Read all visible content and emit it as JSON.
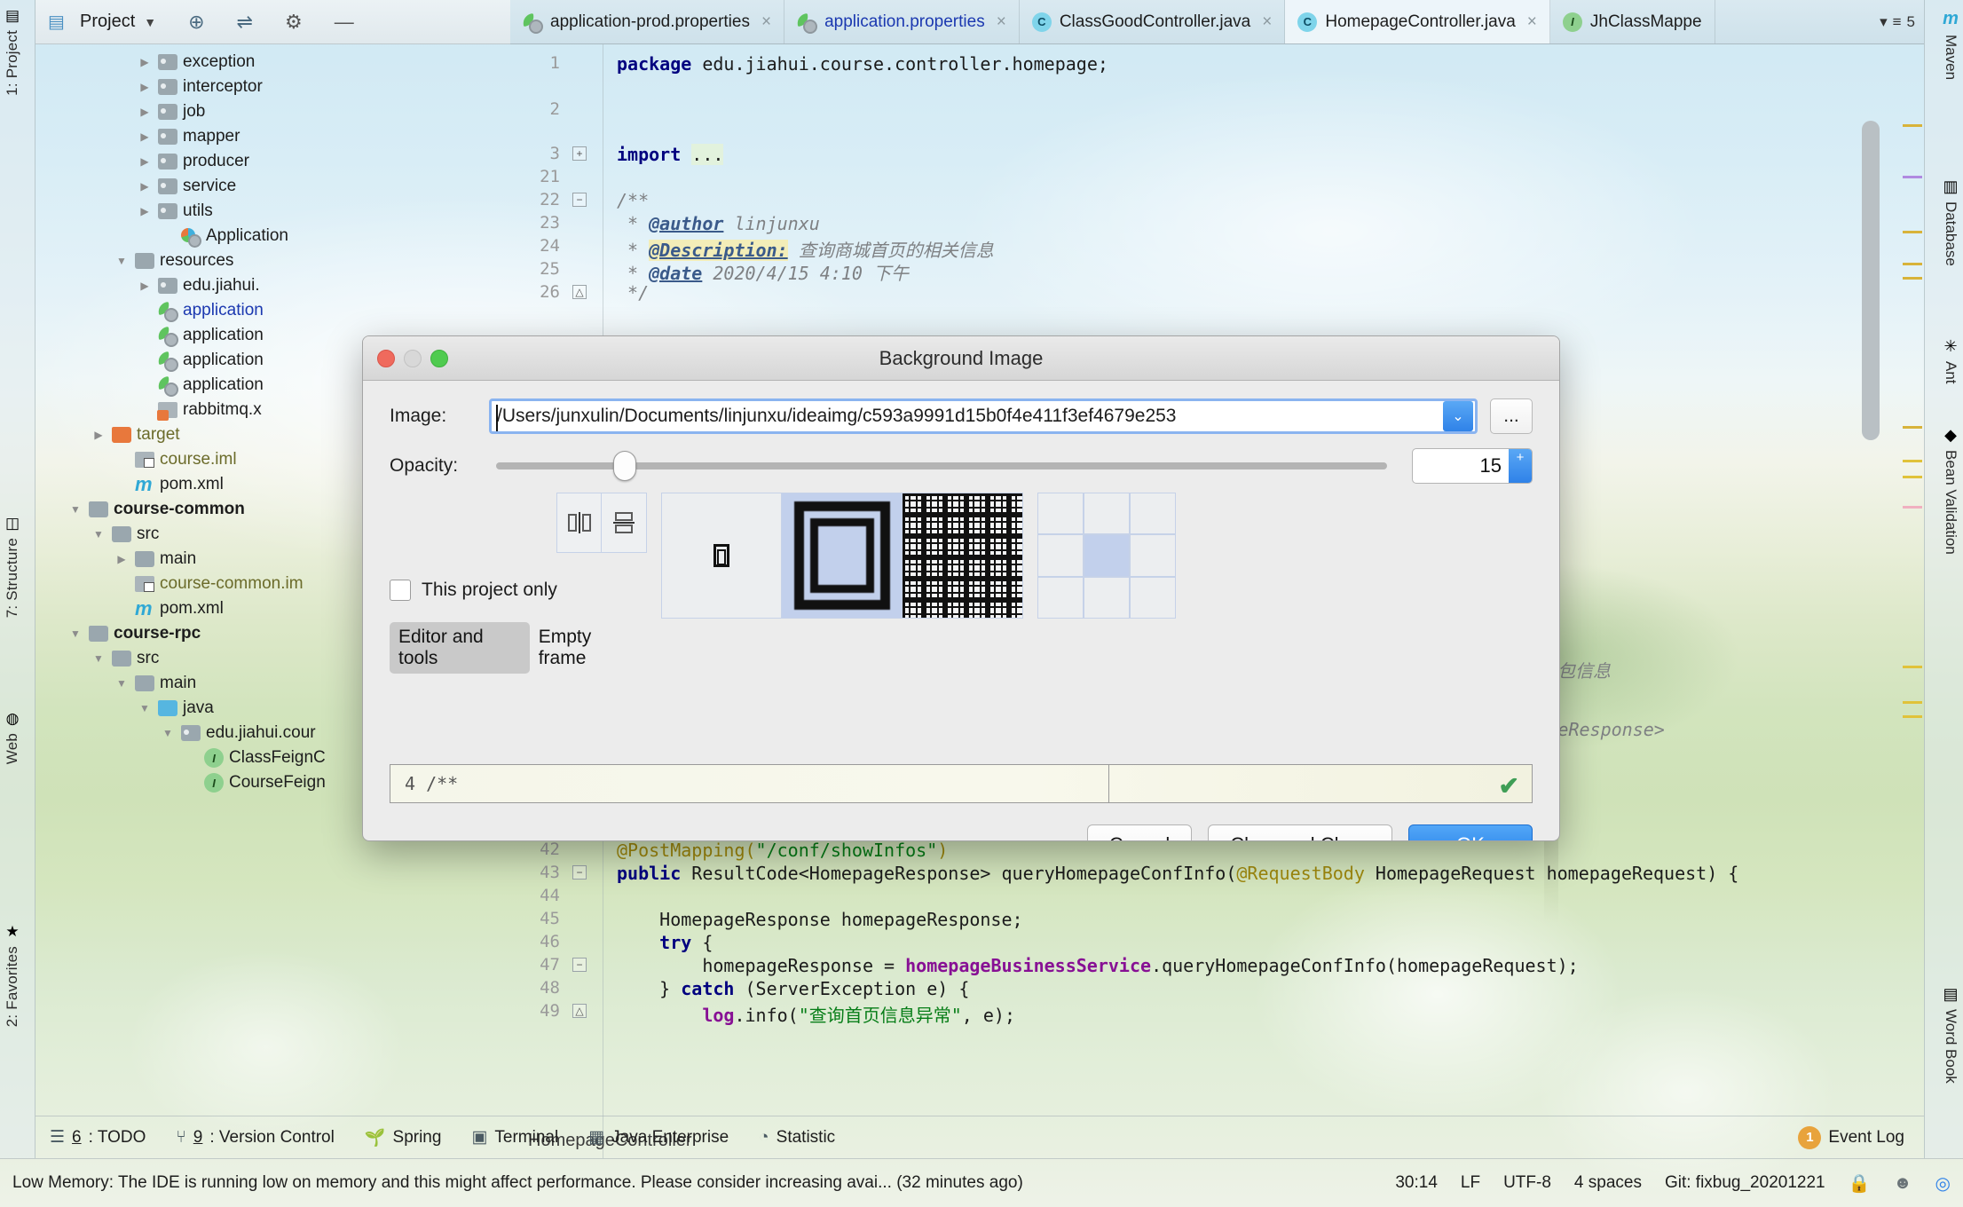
{
  "window": {
    "left_rail": [
      {
        "label": "1: Project",
        "icon": "project-icon"
      },
      {
        "label": "7: Structure",
        "icon": "structure-icon"
      },
      {
        "label": "Web",
        "icon": "web-icon"
      },
      {
        "label": "2: Favorites",
        "icon": "star-icon"
      }
    ],
    "right_rail": [
      {
        "label": "Maven",
        "icon": "maven-icon"
      },
      {
        "label": "Database",
        "icon": "database-icon"
      },
      {
        "label": "Ant",
        "icon": "ant-icon"
      },
      {
        "label": "Bean Validation",
        "icon": "bean-validation-icon"
      },
      {
        "label": "Word Book",
        "icon": "word-book-icon"
      }
    ]
  },
  "project_panel": {
    "title": "Project",
    "toolbar_icons": [
      "project-dropdown-icon",
      "locate-icon",
      "collapse-all-icon",
      "settings-gear-icon",
      "hide-icon"
    ],
    "tree": [
      {
        "label": "exception",
        "indent": 4,
        "arrow": "collapsed",
        "icon": "folder-package-icon",
        "style": ""
      },
      {
        "label": "interceptor",
        "indent": 4,
        "arrow": "collapsed",
        "icon": "folder-package-icon",
        "style": ""
      },
      {
        "label": "job",
        "indent": 4,
        "arrow": "collapsed",
        "icon": "folder-package-icon",
        "style": ""
      },
      {
        "label": "mapper",
        "indent": 4,
        "arrow": "collapsed",
        "icon": "folder-package-icon",
        "style": ""
      },
      {
        "label": "producer",
        "indent": 4,
        "arrow": "collapsed",
        "icon": "folder-package-icon",
        "style": ""
      },
      {
        "label": "service",
        "indent": 4,
        "arrow": "collapsed",
        "icon": "folder-package-icon",
        "style": ""
      },
      {
        "label": "utils",
        "indent": 4,
        "arrow": "collapsed",
        "icon": "folder-package-icon",
        "style": ""
      },
      {
        "label": "Application",
        "indent": 5,
        "arrow": "none",
        "icon": "spring-application-icon",
        "style": ""
      },
      {
        "label": "resources",
        "indent": 3,
        "arrow": "expanded",
        "icon": "folder-resources-icon",
        "style": ""
      },
      {
        "label": "edu.jiahui.",
        "indent": 4,
        "arrow": "collapsed",
        "icon": "folder-package-icon",
        "style": ""
      },
      {
        "label": "application",
        "indent": 4,
        "arrow": "none",
        "icon": "properties-icon",
        "style": "blue"
      },
      {
        "label": "application",
        "indent": 4,
        "arrow": "none",
        "icon": "properties-icon",
        "style": ""
      },
      {
        "label": "application",
        "indent": 4,
        "arrow": "none",
        "icon": "properties-icon",
        "style": ""
      },
      {
        "label": "application",
        "indent": 4,
        "arrow": "none",
        "icon": "properties-icon",
        "style": ""
      },
      {
        "label": "rabbitmq.x",
        "indent": 4,
        "arrow": "none",
        "icon": "xml-file-icon",
        "style": ""
      },
      {
        "label": "target",
        "indent": 2,
        "arrow": "collapsed",
        "icon": "folder-excluded-icon",
        "style": "olive"
      },
      {
        "label": "course.iml",
        "indent": 3,
        "arrow": "none",
        "icon": "iml-file-icon",
        "style": "olive"
      },
      {
        "label": "pom.xml",
        "indent": 3,
        "arrow": "none",
        "icon": "maven-pom-icon",
        "style": ""
      },
      {
        "label": "course-common",
        "indent": 1,
        "arrow": "expanded",
        "icon": "folder-module-icon",
        "style": "bold"
      },
      {
        "label": "src",
        "indent": 2,
        "arrow": "expanded",
        "icon": "folder-plain-icon",
        "style": ""
      },
      {
        "label": "main",
        "indent": 3,
        "arrow": "collapsed",
        "icon": "folder-plain-icon",
        "style": ""
      },
      {
        "label": "course-common.im",
        "indent": 3,
        "arrow": "none",
        "icon": "iml-file-icon",
        "style": "olive"
      },
      {
        "label": "pom.xml",
        "indent": 3,
        "arrow": "none",
        "icon": "maven-pom-icon",
        "style": ""
      },
      {
        "label": "course-rpc",
        "indent": 1,
        "arrow": "expanded",
        "icon": "folder-module-icon",
        "style": "bold"
      },
      {
        "label": "src",
        "indent": 2,
        "arrow": "expanded",
        "icon": "folder-plain-icon",
        "style": ""
      },
      {
        "label": "main",
        "indent": 3,
        "arrow": "expanded",
        "icon": "folder-plain-icon",
        "style": ""
      },
      {
        "label": "java",
        "indent": 4,
        "arrow": "expanded",
        "icon": "folder-source-icon",
        "style": ""
      },
      {
        "label": "edu.jiahui.cour",
        "indent": 5,
        "arrow": "expanded",
        "icon": "folder-package-icon",
        "style": ""
      },
      {
        "label": "ClassFeignC",
        "indent": 6,
        "arrow": "none",
        "icon": "interface-icon",
        "style": ""
      },
      {
        "label": "CourseFeign",
        "indent": 6,
        "arrow": "none",
        "icon": "interface-icon",
        "style": ""
      }
    ]
  },
  "tabs": {
    "items": [
      {
        "label": "application-prod.properties",
        "icon": "properties-file-icon",
        "active": false,
        "label_style": ""
      },
      {
        "label": "application.properties",
        "icon": "properties-file-icon",
        "active": false,
        "label_style": "blue"
      },
      {
        "label": "ClassGoodController.java",
        "icon": "java-class-icon",
        "active": false,
        "label_style": ""
      },
      {
        "label": "HomepageController.java",
        "icon": "java-class-icon",
        "active": true,
        "label_style": ""
      },
      {
        "label": "JhClassMappe",
        "icon": "java-interface-icon",
        "active": false,
        "label_style": ""
      }
    ],
    "overflow_count": "5",
    "close_glyph": "×"
  },
  "editor": {
    "lines": [
      {
        "no": "1",
        "text": "package edu.jiahui.course.controller.homepage;"
      },
      {
        "no": "2",
        "text": ""
      },
      {
        "no": "3",
        "text": "import ..."
      },
      {
        "no": "21",
        "text": ""
      },
      {
        "no": "22",
        "text": "/**"
      },
      {
        "no": "23",
        "text": " * @author linjunxu"
      },
      {
        "no": "24",
        "text": " * @Description: 查询商城首页的相关信息"
      },
      {
        "no": "25",
        "text": " * @date 2020/4/15 4:10 下午"
      },
      {
        "no": "26",
        "text": " */"
      },
      {
        "no": "42",
        "text": "@PostMapping(\"/conf/showInfos\")"
      },
      {
        "no": "43",
        "text": "public ResultCode<HomepageResponse> queryHomepageConfInfo(@RequestBody HomepageRequest homepageRequest) {"
      },
      {
        "no": "44",
        "text": ""
      },
      {
        "no": "45",
        "text": "    HomepageResponse homepageResponse;"
      },
      {
        "no": "46",
        "text": "    try {"
      },
      {
        "no": "47",
        "text": "        homepageResponse = homepageBusinessService.queryHomepageConfInfo(homepageRequest);"
      },
      {
        "no": "48",
        "text": "    } catch (ServerException e) {"
      },
      {
        "no": "49",
        "text": "        log.info(\"查询首页信息异常\", e);"
      }
    ],
    "package_keyword": "package",
    "package_name": " edu.jiahui.course.controller.homepage;",
    "import_keyword": "import",
    "import_ellipsis": "...",
    "doc_open": "/**",
    "doc_author_tag": "@author",
    "doc_author_value": " linjunxu",
    "doc_description_tag": "@Description:",
    "doc_description_value": " 查询商城首页的相关信息",
    "doc_date_tag": "@date",
    "doc_date_value": " 2020/4/15 4:10 下午",
    "doc_close": "*/",
    "partial_right_text": "的课程和课程包信息",
    "partial_right_text2": "se.HomepageResponse>",
    "breadcrumb": "HomepageController"
  },
  "dialog": {
    "title": "Background Image",
    "image_label": "Image:",
    "image_path": "/Users/junxulin/Documents/linjunxu/ideaimg/c593a9991d15b0f4e411f3ef4679e253",
    "browse_label": "...",
    "dropdown_glyph": "⌄",
    "opacity_label": "Opacity:",
    "opacity_value": "15",
    "opacity_percent": 15,
    "stepper_up": "+",
    "stepper_down": "",
    "flip_buttons": [
      {
        "name": "flip-horizontal",
        "glyph": "‖"
      },
      {
        "name": "flip-vertical",
        "glyph": "≡"
      }
    ],
    "checkbox_label": "This project only",
    "checkbox_checked": false,
    "segments": [
      {
        "label": "Editor and tools",
        "selected": true
      },
      {
        "label": "Empty frame",
        "selected": false
      }
    ],
    "fill_modes": [
      {
        "name": "fit-mode",
        "selected": false
      },
      {
        "name": "center-mode",
        "selected": true
      },
      {
        "name": "tile-mode",
        "selected": false
      }
    ],
    "anchor_grid": {
      "selected_index": 4
    },
    "preview_text": "4 /**",
    "preview_check_glyph": "✔",
    "buttons": [
      {
        "label": "Cancel",
        "primary": false
      },
      {
        "label": "Clear and Close",
        "primary": false
      },
      {
        "label": "OK",
        "primary": true
      }
    ],
    "accent_color": "#2f82e8",
    "focus_border_color": "#8ab4f0",
    "selected_tile_color": "#c2d0ec"
  },
  "toolbar_bottom": {
    "items": [
      {
        "num": "6",
        "label": ": TODO",
        "icon": "todo-icon"
      },
      {
        "num": "9",
        "label": ": Version Control",
        "icon": "version-control-icon"
      },
      {
        "num": "",
        "label": "Spring",
        "icon": "spring-icon"
      },
      {
        "num": "",
        "label": "Terminal",
        "icon": "terminal-icon"
      },
      {
        "num": "",
        "label": "Java Enterprise",
        "icon": "java-enterprise-icon"
      },
      {
        "num": "",
        "label": "Statistic",
        "icon": "statistic-icon"
      }
    ],
    "event_log": {
      "label": "Event Log",
      "badge": "1"
    }
  },
  "statusbar": {
    "message": "Low Memory: The IDE is running low on memory and this might affect performance. Please consider increasing avai... (32 minutes ago)",
    "caret": "30:14",
    "line_separator": "LF",
    "encoding": "UTF-8",
    "indent": "4 spaces",
    "git": "Git: fixbug_20201221",
    "icons": [
      "lock-icon",
      "inspector-icon",
      "chrome-icon"
    ]
  }
}
